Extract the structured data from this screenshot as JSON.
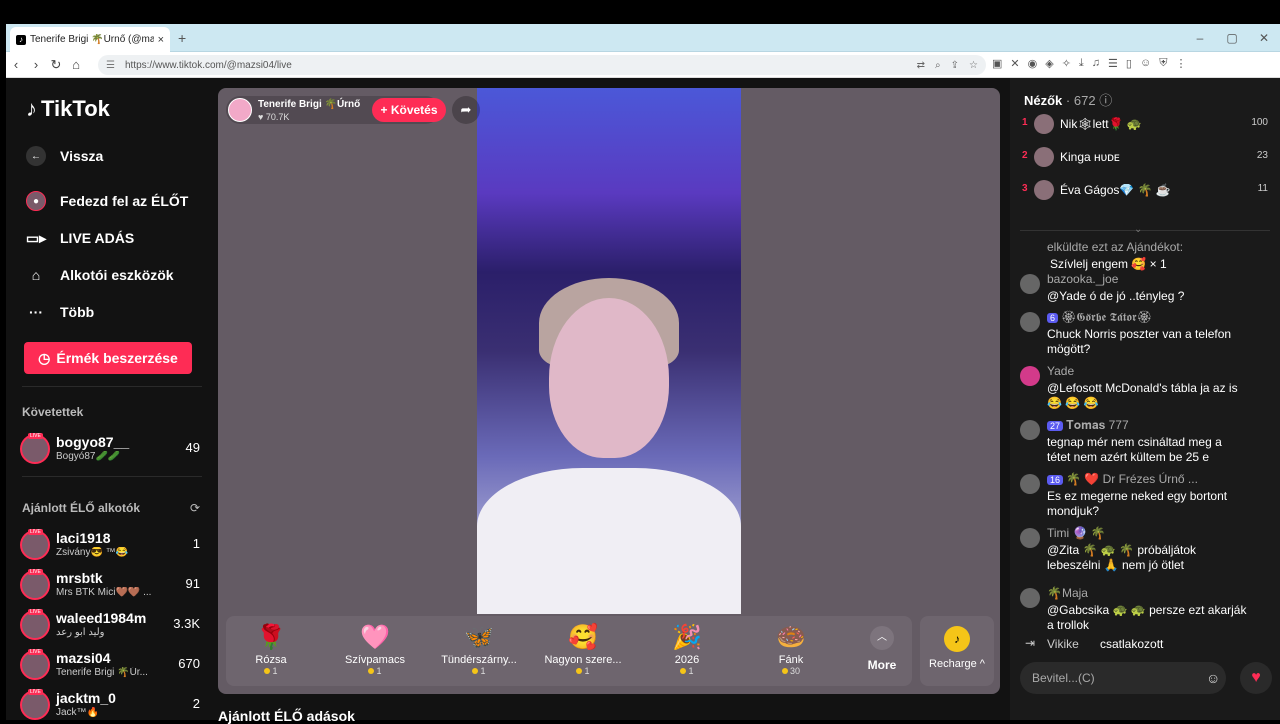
{
  "browser": {
    "tab_title": "Tenerife Brigi 🌴Úrnő (@maz",
    "url_site": "https://www.tiktok.com/@mazsi04/live",
    "new_tab": "+",
    "tab_close": "×",
    "window_controls": [
      "–",
      "▢",
      "✕"
    ]
  },
  "sidebar": {
    "logo": "TikTok",
    "back": "Vissza",
    "nav": [
      "Fedezd fel az ÉLŐT",
      "LIVE ADÁS",
      "Alkotói eszközök",
      "Több"
    ],
    "coins_button": "Érmék beszerzése",
    "following_header": "Követettek",
    "following": [
      {
        "name": "bogyo87__",
        "sub": "Bogyó87🥒🥒",
        "count": "49"
      }
    ],
    "recommended_header": "Ajánlott ÉLŐ alkotók",
    "recommended": [
      {
        "name": "laci1918",
        "sub": "Zsivány😎 ™😂",
        "count": "1"
      },
      {
        "name": "mrsbtk",
        "sub": "Mrs BTK Mici🤎🤎 ...",
        "count": "91"
      },
      {
        "name": "waleed1984m",
        "sub": "وليد ابو رعد",
        "count": "3.3K"
      },
      {
        "name": "mazsi04",
        "sub": "Tenerife Brigi 🌴Úr...",
        "count": "670"
      },
      {
        "name": "jacktm_0",
        "sub": "Jack™🔥",
        "count": "2"
      }
    ],
    "recommended_live_footer": "Ajánlott ÉLŐ adások"
  },
  "stream": {
    "streamer_name": "Tenerife Brigi 🌴Úrnő",
    "likes": "♥ 70.7K",
    "follow_button": "+ Követés",
    "gifts": [
      {
        "icon": "🌹",
        "name": "Rózsa",
        "price": "1"
      },
      {
        "icon": "🩷",
        "name": "Szívpamacs",
        "price": "1"
      },
      {
        "icon": "🦋",
        "name": "Tündérszárny...",
        "price": "1"
      },
      {
        "icon": "🥰",
        "name": "Nagyon szere...",
        "price": "1"
      },
      {
        "icon": "🎉",
        "name": "2026",
        "price": "1"
      },
      {
        "icon": "🍩",
        "name": "Fánk",
        "price": "30"
      }
    ],
    "more_label": "More",
    "recharge_label": "Recharge ^"
  },
  "viewers": {
    "title": "Nézők",
    "count": "· 672",
    "top": [
      {
        "rank": "1",
        "name": "Nik🕸lett🌹 🐢",
        "score": "100"
      },
      {
        "rank": "2",
        "name": "Kinga ʜᴜᴅᴇ",
        "score": "23"
      },
      {
        "rank": "3",
        "name": "Éva Gágos💎 🌴 ☕",
        "score": "11"
      }
    ]
  },
  "chat": {
    "messages": [
      {
        "user": "elküldte ezt az Ajándékot:",
        "text": "Szívlelj engem 🥰 × 1",
        "badge": ""
      },
      {
        "user": "bazooka._joe",
        "text": "@Yade ó de jó ..tényleg ?",
        "badge": ""
      },
      {
        "user": "🏵𝕲𝖔̈𝖗𝖇𝖊 𝕿𝖆́𝖙𝖔𝖗🏵",
        "text": "Chuck Norris poszter van a telefon mögött?",
        "badge": "6"
      },
      {
        "user": "Yade",
        "text": "@Lefosott McDonald's tábla ja az is 😂 😂 😂",
        "badge": ""
      },
      {
        "user": "𝐓𝐨𝐦𝐚𝐬 777",
        "text": "tegnap mér nem csináltad meg a tétet nem azért kültem be 25 e",
        "badge": "27"
      },
      {
        "user": "🌴 ❤️ Dr Frézes Úrnő ...",
        "text": "Es ez megerne neked egy bortont mondjuk?",
        "badge": "16"
      },
      {
        "user": "Timi 🔮 🌴",
        "text": "@Zita 🌴 🐢 🌴 próbáljátok lebeszélni 🙏 nem jó ötlet",
        "badge": ""
      },
      {
        "user": "🌴Maja",
        "text": "@Gabcsika 🐢 🐢 persze ezt akarják a trollok",
        "badge": ""
      }
    ],
    "join_user": "Vikike",
    "join_text": "csatlakozott",
    "input_placeholder": "Bevitel...(C)"
  }
}
